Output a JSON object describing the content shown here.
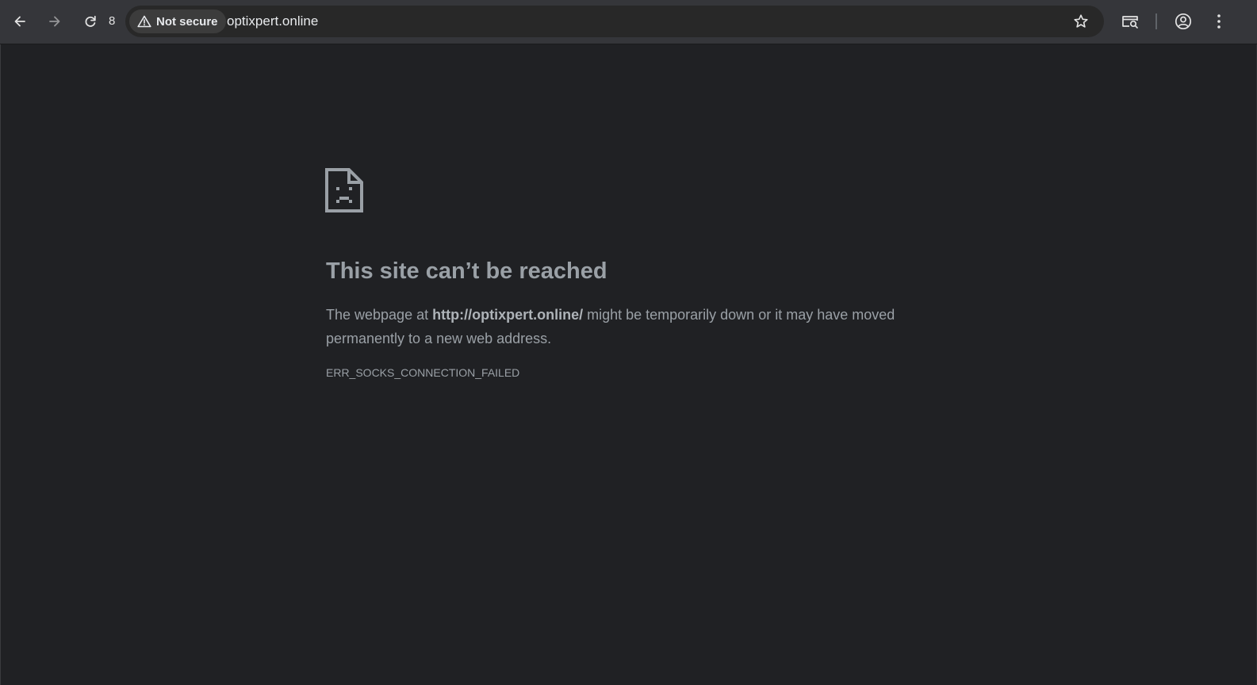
{
  "toolbar": {
    "back_icon": "arrow-left-icon",
    "forward_icon": "arrow-right-icon",
    "reload_icon": "reload-icon",
    "reload_count": "8",
    "security_label": "Not secure",
    "security_icon": "warning-triangle-icon",
    "url": "optixpert.online",
    "bookmark_icon": "star-icon",
    "tab_search_icon": "tab-search-icon",
    "profile_icon": "profile-icon",
    "menu_icon": "kebab-menu-icon"
  },
  "error_page": {
    "icon": "sad-document-icon",
    "title": "This site can’t be reached",
    "desc_prefix": "The webpage at ",
    "desc_url": "http://optixpert.online/",
    "desc_suffix": " might be temporarily down or it may have moved permanently to a new web address.",
    "error_code": "ERR_SOCKS_CONNECTION_FAILED"
  },
  "colors": {
    "toolbar_bg": "#35363a",
    "omnibox_bg": "#282828",
    "page_bg": "#202124",
    "text_muted": "#9aa0a6",
    "icon_color": "#e3e3e3"
  }
}
